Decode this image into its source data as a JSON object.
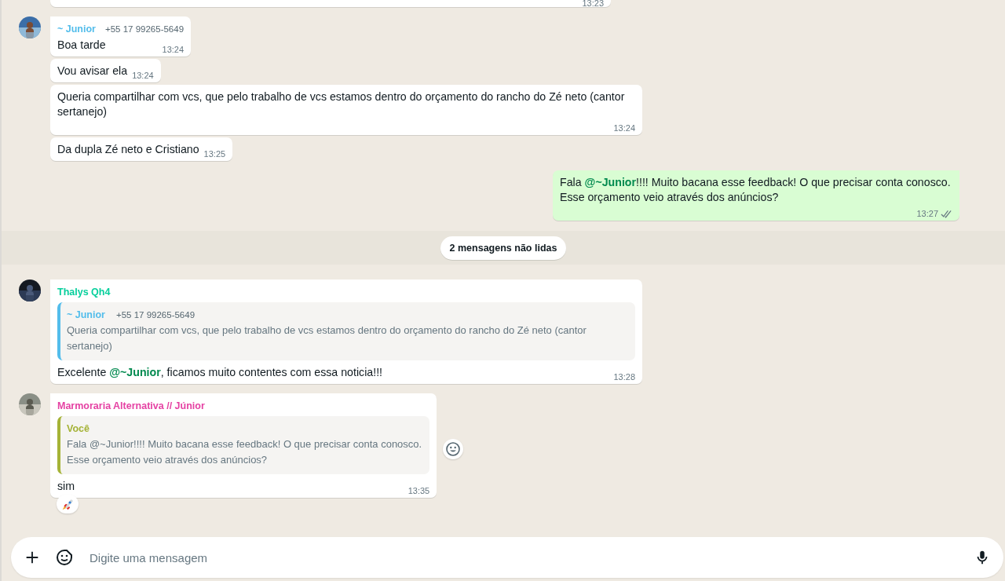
{
  "messages": [
    {
      "kind": "cut",
      "time": "13:23"
    },
    {
      "kind": "incoming",
      "first": true,
      "author": "~ Junior",
      "color": "#53bdeb",
      "phone": "+55 17 99265-5649",
      "text": "Boa tarde",
      "time": "13:24"
    },
    {
      "kind": "incoming",
      "first": false,
      "text": "Vou avisar ela",
      "time": "13:24"
    },
    {
      "kind": "incoming",
      "first": false,
      "text": "Queria compartilhar com vcs, que pelo trabalho de vcs estamos dentro do orçamento do rancho do Zé neto (cantor sertanejo)",
      "time": "13:24"
    },
    {
      "kind": "incoming",
      "first": false,
      "text": "Da dupla Zé neto e Cristiano",
      "time": "13:25"
    },
    {
      "kind": "outgoing",
      "text": "Fala **@~Junior**!!!! Muito bacana esse feedback! O que precisar conta conosco.\nEsse orçamento veio através dos anúncios?",
      "time": "13:27",
      "read": false
    },
    {
      "kind": "divider",
      "text": "2 mensagens não lidas"
    },
    {
      "kind": "incoming",
      "first": true,
      "author": "Thalys Qh4",
      "color": "#06cf9c",
      "quote": {
        "author": "~ Junior",
        "color": "#53bdeb",
        "phone": "+55 17 99265-5649",
        "text": "Queria compartilhar com vcs, que pelo trabalho de vcs estamos dentro do orçamento do rancho do Zé neto (cantor sertanejo)"
      },
      "text": "Excelente **@~Junior**, ficamos muito contentes com essa noticia!!!",
      "time": "13:28"
    },
    {
      "kind": "incoming",
      "first": true,
      "author": "Marmoraria Alternativa // Júnior",
      "color": "#e542a3",
      "quote": {
        "author": "Você",
        "color": "#a5b337",
        "text": "Fala @~Junior!!!! Muito bacana esse feedback! O que precisar conta conosco.\nEsse orçamento veio através dos anúncios?"
      },
      "text": "sim",
      "time": "13:35",
      "react_button": true,
      "reaction": true
    }
  ],
  "composer": {
    "placeholder": "Digite uma mensagem"
  }
}
